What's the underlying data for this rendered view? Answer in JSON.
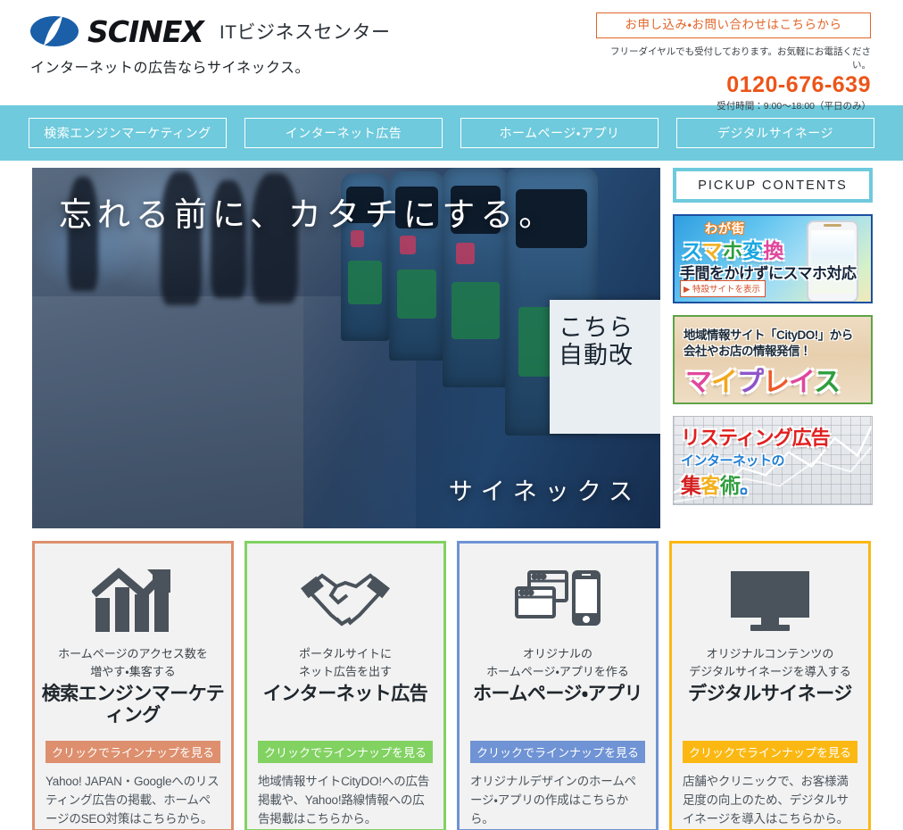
{
  "header": {
    "logo_icon": "scinex-swoosh-logo",
    "brand_name": "SCINEX",
    "brand_sub": "ITビジネスセンター",
    "tagline": "インターネットの広告ならサイネックス。",
    "contact": {
      "cta_label": "お申し込み・お問い合わせはこちらから",
      "note": "フリーダイヤルでも受付しております。お気軽にお電話ください。",
      "tel": "0120-676-639",
      "hours": "受付時間：9:00〜18:00（平日のみ）",
      "accent_color": "#ec5519"
    }
  },
  "nav": {
    "background_color": "#6ecadc",
    "items": [
      {
        "label": "検索エンジンマーケティング"
      },
      {
        "label": "インターネット広告"
      },
      {
        "label": "ホームページ・アプリ"
      },
      {
        "label": "デジタルサイネージ"
      }
    ]
  },
  "hero": {
    "headline": "忘れる前に、カタチにする。",
    "subtitle": "サイネックス",
    "sign_text_line1": "こちら",
    "sign_text_line2": "自動改"
  },
  "sidebar": {
    "pickup_title": "PICKUP CONTENTS",
    "accent_color": "#6ecadc",
    "banners": [
      {
        "name": "smartphone-conversion-banner",
        "badge": "わが街",
        "title_parts": [
          "ス",
          "マ",
          "ホ",
          "変",
          "換"
        ],
        "subtitle": "手間をかけずにスマホ対応",
        "button_label": "▶ 特設サイトを表示"
      },
      {
        "name": "myplace-banner",
        "line1": "地域情報サイト「CityDO!」から",
        "line2": "会社やお店の情報発信！",
        "title_parts": [
          "マ",
          "イ",
          "プ",
          "レ",
          "イ",
          "ス"
        ]
      },
      {
        "name": "listing-ad-banner",
        "line1": "リスティング広告",
        "line2": "インターネットの",
        "line3_parts": [
          "集",
          "客",
          "術",
          "。"
        ]
      }
    ]
  },
  "cards": [
    {
      "icon": "bar-chart-growth-icon",
      "caption": "ホームページのアクセス数を\n増やす・集客する",
      "title": "検索エンジンマーケティング",
      "cta": "クリックでラインナップを見る",
      "description": "Yahoo! JAPAN・Googleへのリスティング広告の掲載、ホームページのSEO対策はこちらから。",
      "color": "#dd8f6e"
    },
    {
      "icon": "handshake-icon",
      "caption": "ポータルサイトに\nネット広告を出す",
      "title": "インターネット広告",
      "cta": "クリックでラインナップを見る",
      "description": "地域情報サイトCityDO!への広告掲載や、Yahoo!路線情報への広告掲載はこちらから。",
      "color": "#82d262"
    },
    {
      "icon": "browser-smartphone-icon",
      "caption": "オリジナルの\nホームページ・アプリを作る",
      "title": "ホームページ・アプリ",
      "cta": "クリックでラインナップを見る",
      "description": "オリジナルデザインのホームページ・アプリの作成はこちらから。",
      "color": "#6f93d4"
    },
    {
      "icon": "monitor-display-icon",
      "caption": "オリジナルコンテンツの\nデジタルサイネージを導入する",
      "title": "デジタルサイネージ",
      "cta": "クリックでラインナップを見る",
      "description": "店舗やクリニックで、お客様満足度の向上のため、デジタルサイネージを導入はこちらから。",
      "color": "#fbb813"
    }
  ]
}
